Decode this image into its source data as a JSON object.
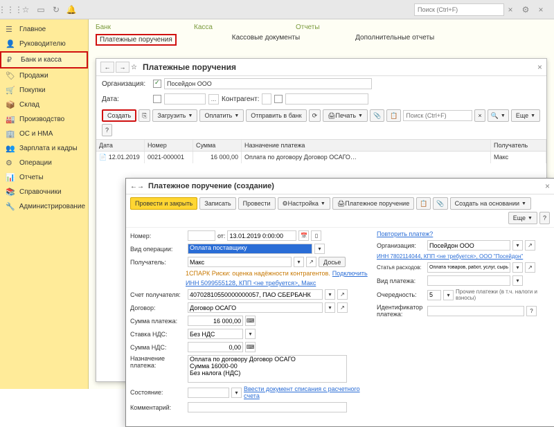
{
  "topbar": {
    "search_placeholder": "Поиск (Ctrl+F)"
  },
  "sidebar": {
    "items": [
      {
        "icon": "☰",
        "label": "Главное"
      },
      {
        "icon": "👤",
        "label": "Руководителю"
      },
      {
        "icon": "₽",
        "label": "Банк и касса"
      },
      {
        "icon": "🏷",
        "label": "Продажи"
      },
      {
        "icon": "🛒",
        "label": "Покупки"
      },
      {
        "icon": "📦",
        "label": "Склад"
      },
      {
        "icon": "🏭",
        "label": "Производство"
      },
      {
        "icon": "🏢",
        "label": "ОС и НМА"
      },
      {
        "icon": "👥",
        "label": "Зарплата и кадры"
      },
      {
        "icon": "⚙",
        "label": "Операции"
      },
      {
        "icon": "📊",
        "label": "Отчеты"
      },
      {
        "icon": "📚",
        "label": "Справочники"
      },
      {
        "icon": "🔧",
        "label": "Администрирование"
      }
    ]
  },
  "sections": {
    "bank": "Банк",
    "kassa": "Касса",
    "reports": "Отчеты",
    "bank_link": "Платежные поручения",
    "kassa_link": "Кассовые документы",
    "reports_link": "Дополнительные отчеты"
  },
  "list": {
    "title": "Платежные поручения",
    "org_label": "Организация:",
    "org_value": "Посейдон ООО",
    "date_label": "Дата:",
    "contragent_label": "Контрагент:",
    "create": "Создать",
    "load": "Загрузить",
    "pay": "Оплатить",
    "send": "Отправить в банк",
    "print": "Печать",
    "search_placeholder": "Поиск (Ctrl+F)",
    "more": "Еще",
    "cols": {
      "date": "Дата",
      "num": "Номер",
      "sum": "Сумма",
      "purpose": "Назначение платежа",
      "payee": "Получатель"
    },
    "row": {
      "date": "12.01.2019",
      "num": "0021-000001",
      "sum": "16 000,00",
      "purpose": "Оплата по договору Договор ОСАГО…",
      "payee": "Макс"
    }
  },
  "modal": {
    "title": "Платежное поручение (создание)",
    "post_close": "Провести и закрыть",
    "save": "Записать",
    "post": "Провести",
    "settings": "Настройка",
    "print_doc": "Платежное поручение",
    "create_based": "Создать на основании",
    "more": "Еще",
    "number_label": "Номер:",
    "from_label": "от:",
    "date_value": "13.01.2019 0:00:00",
    "repeat_link": "Повторить платеж?",
    "op_label": "Вид операции:",
    "op_value": "Оплата поставщику",
    "org_label": "Организация:",
    "org_value": "Посейдон ООО",
    "payee_label": "Получатель:",
    "payee_value": "Макс",
    "dossier": "Досье",
    "inn_link": "ИНН 7802114044, КПП <не требуется>, ООО \"Посейдон\"",
    "spark_text": "1СПАРК Риски: оценка надёжности контрагентов.",
    "spark_link": "Подключить",
    "expense_label": "Статья расходов:",
    "expense_value": "Оплата товаров, работ, услуг, сырья и иных оборотных активов",
    "inn2_link": "ИНН 5099555128, КПП <не требуется>, Макс",
    "paytype_label": "Вид платежа:",
    "account_label": "Счет получателя:",
    "account_value": "40702810550000000057, ПАО СБЕРБАНК",
    "priority_label": "Очередность:",
    "priority_value": "5",
    "priority_hint": "Прочие платежи (в т.ч. налоги и взносы)",
    "contract_label": "Договор:",
    "contract_value": "Договор ОСАГО",
    "ident_label": "Идентификатор платежа:",
    "sum_label": "Сумма платежа:",
    "sum_value": "16 000,00",
    "vat_rate_label": "Ставка НДС:",
    "vat_rate_value": "Без НДС",
    "vat_sum_label": "Сумма НДС:",
    "purpose_label": "Назначение платежа:",
    "purpose_value": "Оплата по договору Договор ОСАГО\nСумма 16000-00\nБез налога (НДС)",
    "state_label": "Состояние:",
    "state_link": "Ввести документ списания с расчетного счета",
    "comment_label": "Комментарий:"
  }
}
